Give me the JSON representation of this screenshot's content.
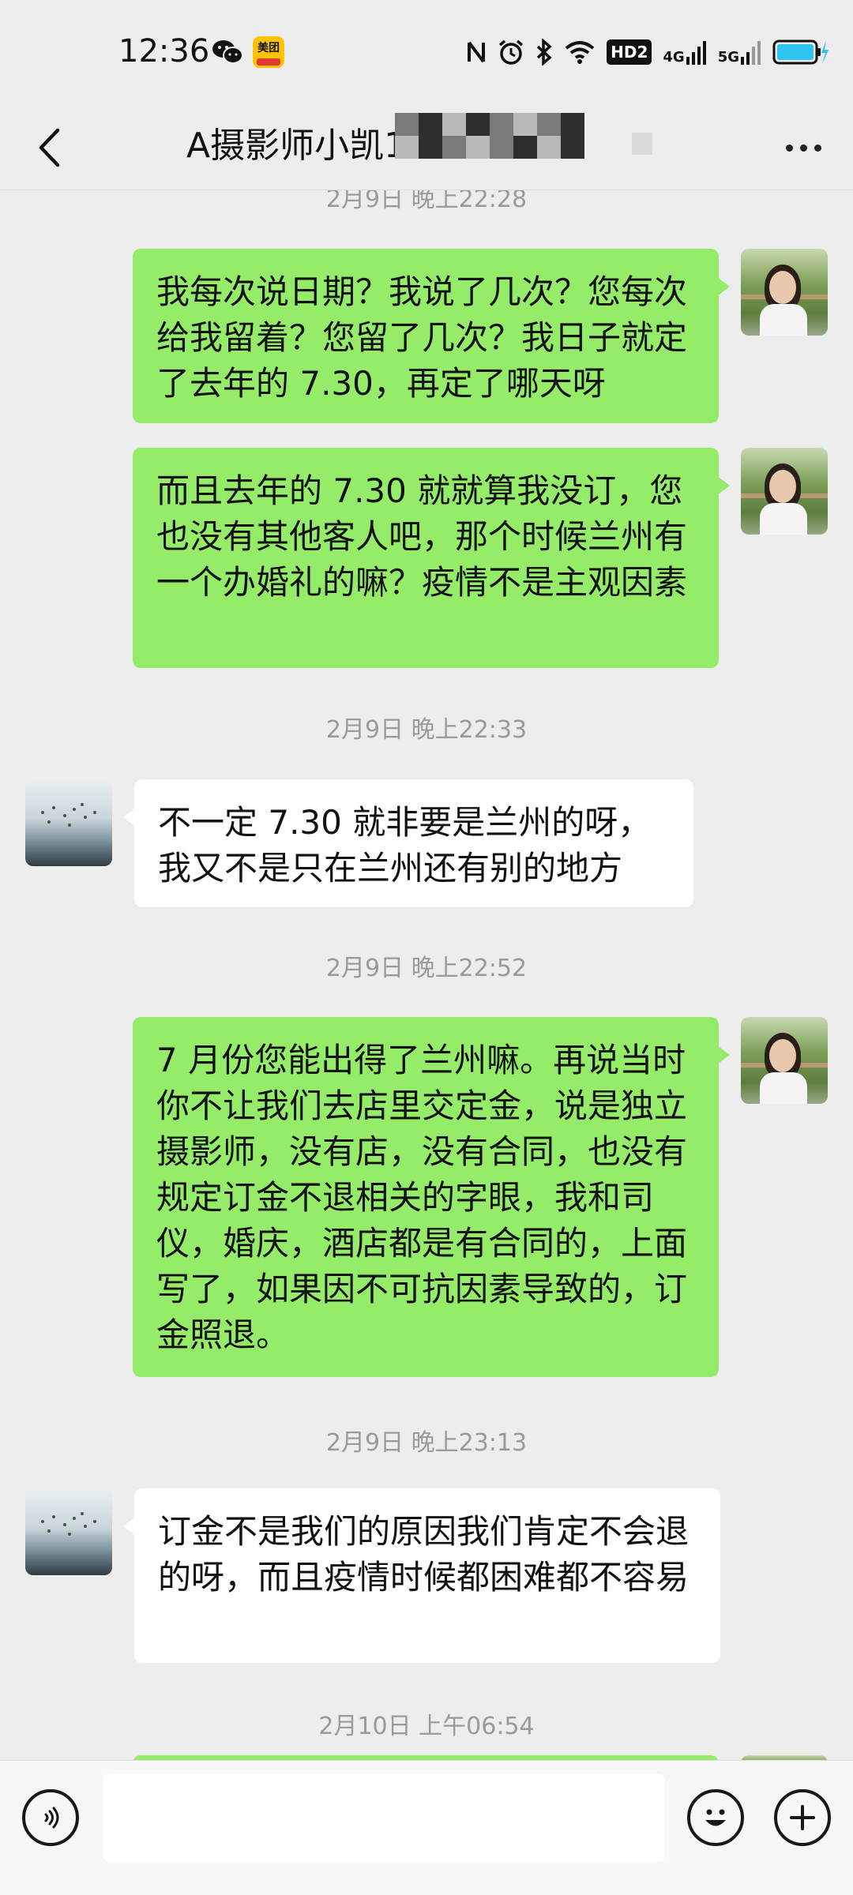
{
  "status_bar": {
    "time": "12:36",
    "wechat_icon": "wechat-icon",
    "meituan_label": "美团",
    "hd_label": "HD2",
    "net_1": "4G",
    "net_2": "5G",
    "battery_color": "#2ec4f0"
  },
  "nav": {
    "title": "A摄影师小凯1",
    "back_icon": "chevron-left-icon",
    "more_icon": "more-dots-icon"
  },
  "messages": [
    {
      "type": "time",
      "text": "2月9日 晚上22:28"
    },
    {
      "type": "out",
      "text": "我每次说日期？我说了几次？您每次给我留着？您留了几次？我日子就定了去年的 7.30，再定了哪天呀"
    },
    {
      "type": "out",
      "text": "而且去年的 7.30 就就算我没订，您也没有其他客人吧，那个时候兰州有一个办婚礼的嘛？疫情不是主观因素"
    },
    {
      "type": "time",
      "text": "2月9日 晚上22:33"
    },
    {
      "type": "in",
      "text": "不一定 7.30 就非要是兰州的呀，我又不是只在兰州还有别的地方"
    },
    {
      "type": "time",
      "text": "2月9日 晚上22:52"
    },
    {
      "type": "out",
      "text": "7 月份您能出得了兰州嘛。再说当时你不让我们去店里交定金，说是独立摄影师，没有店，没有合同，也没有规定订金不退相关的字眼，我和司仪，婚庆，酒店都是有合同的，上面写了，如果因不可抗因素导致的，订金照退。"
    },
    {
      "type": "time",
      "text": "2月9日 晚上23:13"
    },
    {
      "type": "in",
      "text": "订金不是我们的原因我们肯定不会退的呀，而且疫情时候都困难都不容易"
    },
    {
      "type": "time",
      "text": "2月10日 上午06:54"
    }
  ],
  "input_bar": {
    "voice_icon": "voice-icon",
    "emoji_icon": "emoji-icon",
    "plus_icon": "plus-icon",
    "input_value": ""
  },
  "colors": {
    "out_bubble": "#95ec69",
    "in_bubble": "#ffffff",
    "background": "#ededed"
  }
}
